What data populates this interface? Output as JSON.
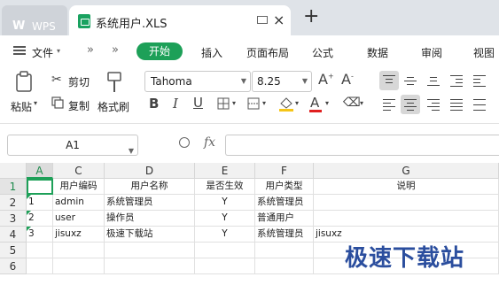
{
  "tabs": {
    "app_tab": "WPS",
    "file_tab": "系统用户.XLS",
    "close_symbol": "×",
    "new_tab_symbol": "+"
  },
  "menu": {
    "file": "文件",
    "items": [
      "开始",
      "插入",
      "页面布局",
      "公式",
      "数据",
      "审阅",
      "视图"
    ],
    "accent_color": "#1da058"
  },
  "ribbon": {
    "paste": "粘贴",
    "cut": "剪切",
    "copy": "复制",
    "format_painter": "格式刷",
    "font_name": "Tahoma",
    "font_size": "8.25"
  },
  "formula_bar": {
    "cell_ref": "A1",
    "fx": "fx",
    "value": ""
  },
  "sheet": {
    "columns": [
      "A",
      "C",
      "D",
      "E",
      "F",
      "G"
    ],
    "rows": [
      "1",
      "2",
      "3",
      "4",
      "5",
      "6"
    ],
    "header_row": [
      "",
      "用户编码",
      "用户名称",
      "是否生效",
      "用户类型",
      "说明"
    ],
    "data": [
      [
        "1",
        "admin",
        "系统管理员",
        "Y",
        "系统管理员",
        ""
      ],
      [
        "2",
        "user",
        "操作员",
        "Y",
        "普通用户",
        ""
      ],
      [
        "3",
        "jisuxz",
        "极速下载站",
        "Y",
        "系统管理员",
        "jisuxz"
      ]
    ]
  },
  "watermark": "极速下载站"
}
